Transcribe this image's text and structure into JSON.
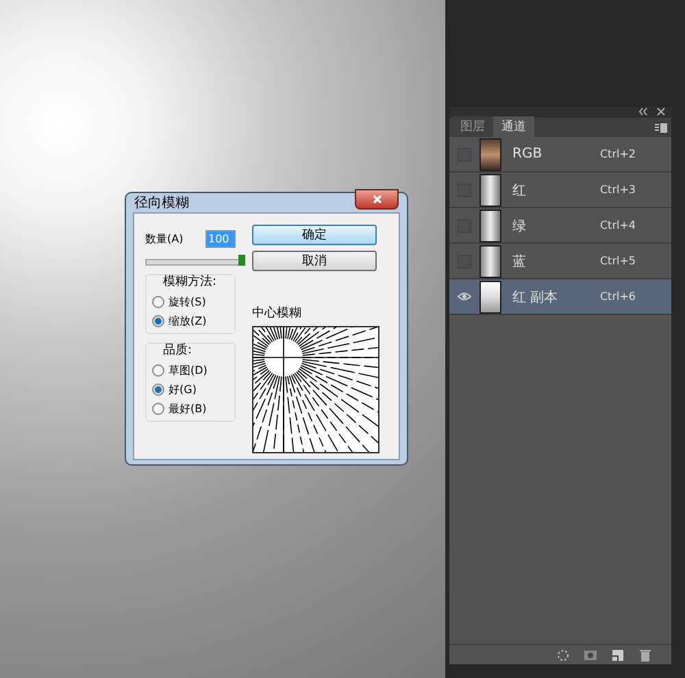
{
  "dialog": {
    "title": "径向模糊",
    "amount": {
      "label": "数量(A)",
      "value": "100",
      "level": 1.0
    },
    "buttons": [
      {
        "label": "确定",
        "default": true
      },
      {
        "label": "取消",
        "default": false
      }
    ],
    "blur_method": {
      "label": "模糊方法:",
      "options": [
        {
          "label": "旋转(S)",
          "selected": false
        },
        {
          "label": "缩放(Z)",
          "selected": true
        }
      ]
    },
    "quality": {
      "label": "品质:",
      "options": [
        {
          "label": "草图(D)",
          "selected": false
        },
        {
          "label": "好(G)",
          "selected": true
        },
        {
          "label": "最好(B)",
          "selected": false
        }
      ]
    },
    "center_label": "中心模糊"
  },
  "channels_panel": {
    "tabs": [
      {
        "label": "图层",
        "selected": false
      },
      {
        "label": "通道",
        "selected": true
      }
    ],
    "channels": [
      {
        "name": "RGB",
        "shortcut": "Ctrl+2",
        "visible": false,
        "selected": false,
        "kind": "color"
      },
      {
        "name": "红",
        "shortcut": "Ctrl+3",
        "visible": false,
        "selected": false,
        "kind": "gray"
      },
      {
        "name": "绿",
        "shortcut": "Ctrl+4",
        "visible": false,
        "selected": false,
        "kind": "gray"
      },
      {
        "name": "蓝",
        "shortcut": "Ctrl+5",
        "visible": false,
        "selected": false,
        "kind": "gray"
      },
      {
        "name": "红 副本",
        "shortcut": "Ctrl+6",
        "visible": true,
        "selected": true,
        "kind": "bright"
      }
    ]
  }
}
